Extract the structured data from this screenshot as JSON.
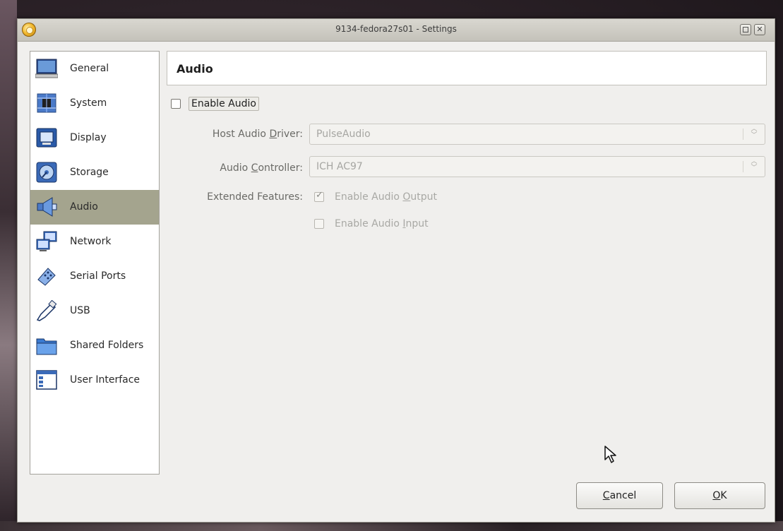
{
  "window": {
    "title": "9134-fedora27s01 - Settings"
  },
  "sidebar": {
    "items": [
      {
        "label": "General",
        "icon": "monitor-icon"
      },
      {
        "label": "System",
        "icon": "chip-icon"
      },
      {
        "label": "Display",
        "icon": "display-icon"
      },
      {
        "label": "Storage",
        "icon": "disk-icon"
      },
      {
        "label": "Audio",
        "icon": "speaker-icon",
        "selected": true
      },
      {
        "label": "Network",
        "icon": "network-icon"
      },
      {
        "label": "Serial Ports",
        "icon": "serial-port-icon"
      },
      {
        "label": "USB",
        "icon": "usb-icon"
      },
      {
        "label": "Shared Folders",
        "icon": "folder-icon"
      },
      {
        "label": "User Interface",
        "icon": "window-icon"
      }
    ]
  },
  "main": {
    "header_title": "Audio",
    "enable_audio": {
      "label": "Enable Audio",
      "checked": false
    },
    "host_driver": {
      "label_pre": "Host Audio ",
      "label_key": "D",
      "label_post": "river:",
      "value": "PulseAudio"
    },
    "controller": {
      "label_pre": "Audio ",
      "label_key": "C",
      "label_post": "ontroller:",
      "value": "ICH AC97"
    },
    "extended": {
      "label": "Extended Features:",
      "output": {
        "label_pre": "Enable Audio ",
        "label_key": "O",
        "label_post": "utput",
        "checked": true
      },
      "input": {
        "label_pre": "Enable Audio ",
        "label_key": "I",
        "label_post": "nput",
        "checked": false
      }
    }
  },
  "buttons": {
    "cancel_key": "C",
    "cancel_rest": "ancel",
    "ok_key": "O",
    "ok_rest": "K"
  },
  "colors": {
    "selected_bg": "#a4a48e",
    "window_bg": "#f0efed"
  }
}
